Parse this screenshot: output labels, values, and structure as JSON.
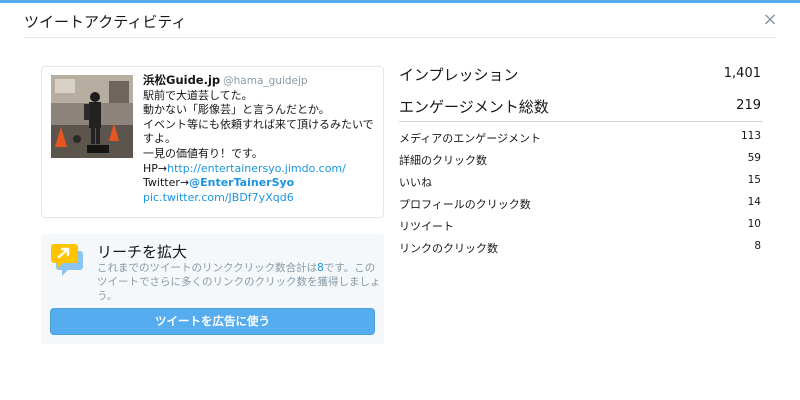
{
  "modal": {
    "title": "ツイートアクティビティ",
    "close_label": "×"
  },
  "tweet": {
    "name": "浜松Guide.jp",
    "handle": "@hama_guidejp",
    "lines": [
      "駅前で大道芸してた。",
      "動かない「彫像芸」と言うんだとか。",
      "イベント等にも依頼すれば来て頂けるみたいですよ。",
      "一見の価値有り！です。"
    ],
    "hp_prefix": "HP→",
    "hp_link": "http://entertainersyo.jimdo.com/",
    "twitter_prefix": "Twitter→",
    "twitter_mention": "@EnterTainerSyo",
    "pic_link": "pic.twitter.com/JBDf7yXqd6"
  },
  "promo": {
    "title": "リーチを拡大",
    "text_before": "これまでのツイートのリンククリック数合計は",
    "count": "8",
    "text_after": "です。このツイートでさらに多くのリンクのクリック数を獲得しましょう。",
    "button_label": "ツイートを広告に使う"
  },
  "stats": {
    "primary": [
      {
        "label": "インプレッション",
        "value": "1,401"
      },
      {
        "label": "エンゲージメント総数",
        "value": "219"
      }
    ],
    "breakdown": [
      {
        "label": "メディアのエンゲージメント",
        "value": "113"
      },
      {
        "label": "詳細のクリック数",
        "value": "59"
      },
      {
        "label": "いいね",
        "value": "15"
      },
      {
        "label": "プロフィールのクリック数",
        "value": "14"
      },
      {
        "label": "リツイート",
        "value": "10"
      },
      {
        "label": "リンクのクリック数",
        "value": "8"
      }
    ]
  },
  "colors": {
    "accent": "#55acee",
    "link": "#1b95e0",
    "muted": "#8899a6",
    "promo_bg": "#f5f8fa",
    "icon_yellow": "#ffc400"
  }
}
